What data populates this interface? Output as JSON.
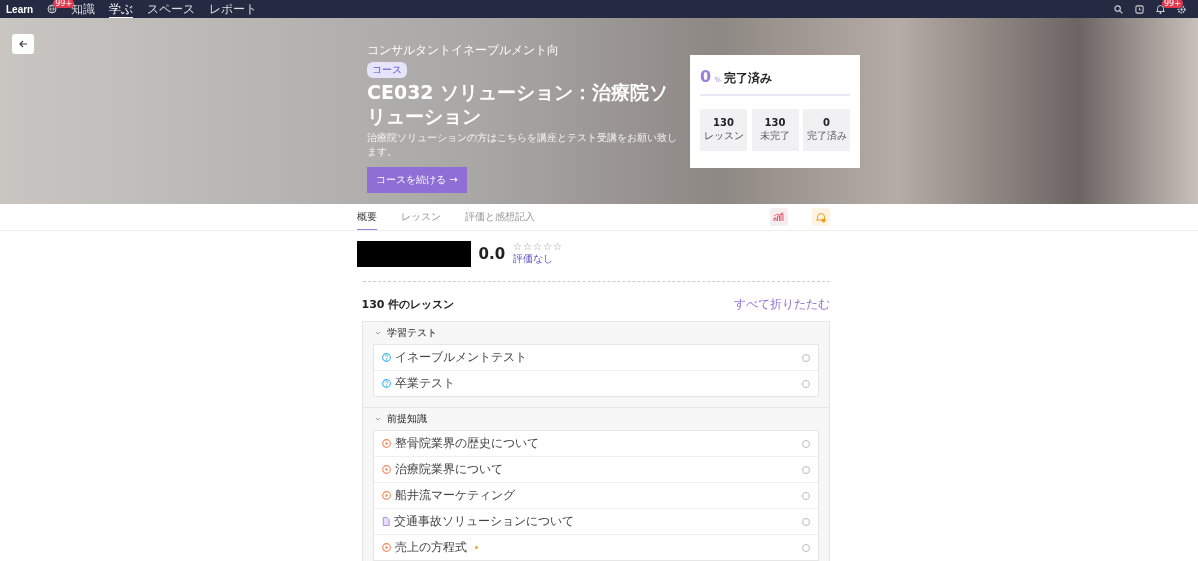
{
  "nav": {
    "logo": "Learn",
    "badge": "99+",
    "items": [
      {
        "label": "知識",
        "selected": false
      },
      {
        "label": "学ぶ",
        "selected": true
      },
      {
        "label": "スペース",
        "selected": false
      },
      {
        "label": "レポート",
        "selected": false
      }
    ],
    "bell_badge": "99+"
  },
  "hero": {
    "breadcrumb": "コンサルタントイネーブルメント向",
    "tag": "コース",
    "title": "CE032 ソリューション：治療院ソリューション",
    "description": "治療院ソリューションの方はこちらを講座とテスト受講をお願い致します。",
    "cta": "コースを続ける →",
    "progress": {
      "percent": "0",
      "unit": "%",
      "label": "完了済み",
      "level": 0,
      "stats": [
        {
          "value": "130",
          "label": "レッスン"
        },
        {
          "value": "130",
          "label": "未完了"
        },
        {
          "value": "0",
          "label": "完了済み"
        }
      ]
    }
  },
  "tabs": [
    {
      "label": "概要",
      "selected": true
    },
    {
      "label": "レッスン",
      "selected": false
    },
    {
      "label": "評価と感想記入",
      "selected": false
    }
  ],
  "rating": {
    "score": "0.0",
    "stars": 0,
    "caption": "評価なし"
  },
  "lessons": {
    "heading": "130 件のレッスン",
    "collapse_all": "すべて折りたたむ",
    "sections": [
      {
        "title": "学習テスト",
        "expanded": true,
        "items": [
          {
            "kind": "quiz",
            "title": "イネーブルメントテスト",
            "completed": false,
            "new": false
          },
          {
            "kind": "quiz",
            "title": "卒業テスト",
            "completed": false,
            "new": false
          }
        ]
      },
      {
        "title": "前提知識",
        "expanded": true,
        "items": [
          {
            "kind": "video",
            "title": "整骨院業界の歴史について",
            "completed": false,
            "new": false
          },
          {
            "kind": "video",
            "title": "治療院業界について",
            "completed": false,
            "new": false
          },
          {
            "kind": "video",
            "title": "船井流マーケティング",
            "completed": false,
            "new": false
          },
          {
            "kind": "document",
            "title": "交通事故ソリューションについて",
            "completed": false,
            "new": false
          },
          {
            "kind": "video",
            "title": "売上の方程式",
            "completed": false,
            "new": true
          }
        ]
      }
    ]
  }
}
